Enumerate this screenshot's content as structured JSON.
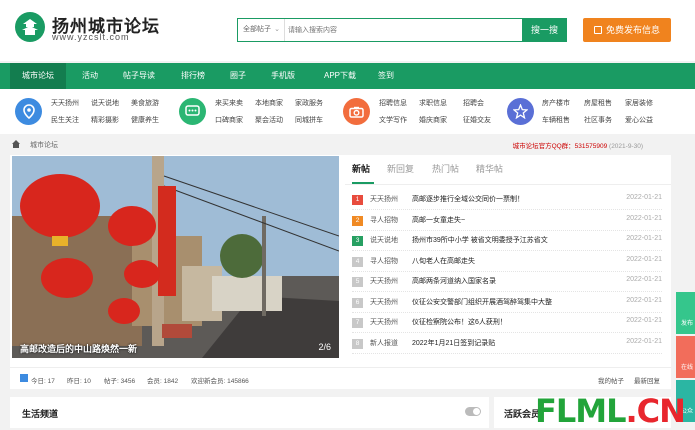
{
  "header": {
    "site_title": "扬州城市论坛",
    "site_url": "www.yzcslt.com",
    "search_select": "全部帖子",
    "search_placeholder": "请输入搜索内容",
    "search_button": "搜一搜",
    "post_button": "免费发布信息"
  },
  "nav": [
    "城市论坛",
    "活动",
    "帖子导读",
    "排行榜",
    "圈子",
    "手机版",
    "APP下载",
    "签到"
  ],
  "quick_groups": [
    {
      "icon": "location-icon",
      "color": "#3d8be0",
      "links": [
        "天天扬州",
        "说天说地",
        "美食旅游",
        "民生关注",
        "精彩摄影",
        "健康养生"
      ]
    },
    {
      "icon": "chat-icon",
      "color": "#2bb673",
      "links": [
        "来买来卖",
        "本地商家",
        "家政服务",
        "口碑商家",
        "聚会活动",
        "同城拼车"
      ]
    },
    {
      "icon": "camera-icon",
      "color": "#f26d3d",
      "links": [
        "招聘信息",
        "求职信息",
        "招聘会",
        "文学写作",
        "婚庆商家",
        "征婚交友"
      ]
    },
    {
      "icon": "star-icon",
      "color": "#5a6fd6",
      "links": [
        "房产楼市",
        "房屋租售",
        "家居装修",
        "车辆租售",
        "社区事务",
        "爱心公益"
      ]
    }
  ],
  "breadcrumb": {
    "current": "城市论坛",
    "qq_group": "城市论坛官方QQ群：531575909",
    "date": "(2021-9-30)"
  },
  "slider": {
    "caption": "高邮改造后的中山路焕然一新",
    "count": "2/6"
  },
  "tabs": [
    "新帖",
    "新回复",
    "热门帖",
    "精华帖"
  ],
  "posts": [
    {
      "num": "1",
      "color": "#e84c3d",
      "cat": "天天扬州",
      "title": "高邮逐步推行全域公交同价一票制！",
      "date": "2022-01-21"
    },
    {
      "num": "2",
      "color": "#f08a24",
      "cat": "寻人招物",
      "title": "高邮一女童走失~",
      "date": "2022-01-21"
    },
    {
      "num": "3",
      "color": "#27a062",
      "cat": "说天说地",
      "title": "扬州市39所中小学 被省文明委授予江苏省文",
      "date": "2022-01-21"
    },
    {
      "num": "4",
      "color": "#c8c8c8",
      "cat": "寻人招物",
      "title": "八旬老人在高邮走失",
      "date": "2022-01-21"
    },
    {
      "num": "5",
      "color": "#c8c8c8",
      "cat": "天天扬州",
      "title": "高邮两条河道纳入国家名录",
      "date": "2022-01-21"
    },
    {
      "num": "6",
      "color": "#c8c8c8",
      "cat": "天天扬州",
      "title": "仪征公安交警部门组织开展酒驾醉驾集中大整",
      "date": "2022-01-21"
    },
    {
      "num": "7",
      "color": "#c8c8c8",
      "cat": "天天扬州",
      "title": "仪征检察院公布！这6人获刑！",
      "date": "2022-01-21"
    },
    {
      "num": "8",
      "color": "#c8c8c8",
      "cat": "新人报道",
      "title": "2022年1月21日签到记录贴",
      "date": "2022-01-21"
    }
  ],
  "stats": {
    "today": "今日: 17",
    "yesterday": "昨日: 10",
    "posts": "帖子: 3456",
    "members": "会员: 1842",
    "welcome": "欢迎新会员: 145866",
    "my_posts": "我的帖子",
    "latest_reply": "最新回复"
  },
  "sections": {
    "life": "生活频道",
    "activity": "活跃会员"
  },
  "float_buttons": [
    {
      "label": "发布",
      "color": "#35c68c"
    },
    {
      "label": "在线",
      "color": "#f26d5b"
    },
    {
      "label": "公众",
      "color": "#2bb6a3"
    }
  ],
  "watermark": {
    "part1": "FLML",
    "part2": ".CN",
    "color1": "#22a43a",
    "color2": "#e8262d"
  }
}
